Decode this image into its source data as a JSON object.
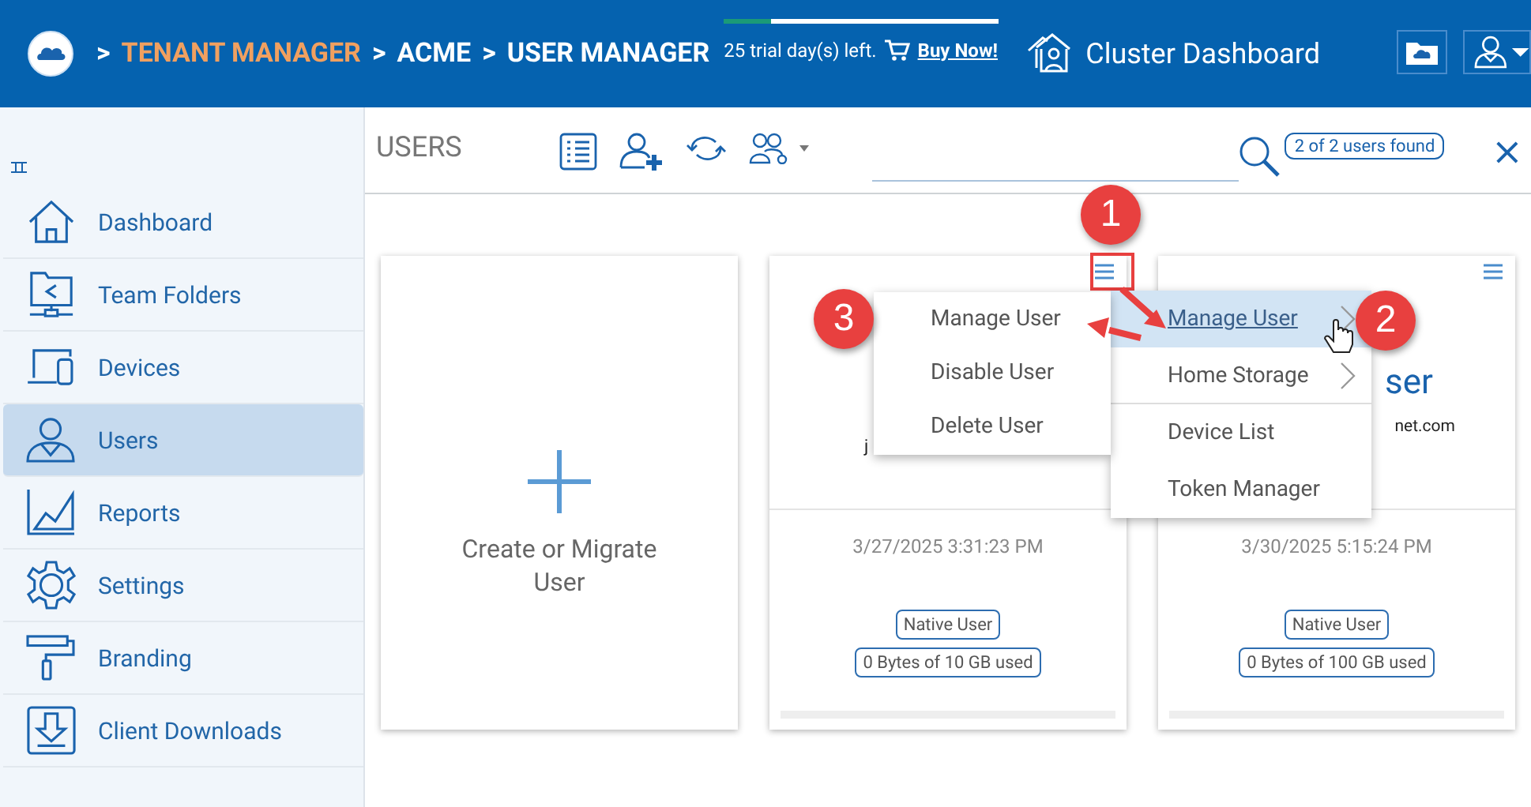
{
  "header": {
    "separator": ">",
    "breadcrumb": [
      {
        "label": "TENANT MANAGER",
        "kind": "link"
      },
      {
        "label": "ACME",
        "kind": "plain"
      },
      {
        "label": "USER MANAGER",
        "kind": "plain"
      }
    ],
    "trial": {
      "text": "25 trial day(s) left.",
      "level": 0.17,
      "buy": "Buy Now!"
    },
    "cluster": "Cluster Dashboard"
  },
  "sidebar": {
    "items": [
      {
        "label": "Dashboard",
        "selected": false
      },
      {
        "label": "Team Folders",
        "selected": false
      },
      {
        "label": "Devices",
        "selected": false
      },
      {
        "label": "Users",
        "selected": true
      },
      {
        "label": "Reports",
        "selected": false
      },
      {
        "label": "Settings",
        "selected": false
      },
      {
        "label": "Branding",
        "selected": false
      },
      {
        "label": "Client Downloads",
        "selected": false
      }
    ]
  },
  "toolbar": {
    "title": "USERS",
    "found": "2 of 2 users found",
    "close": "×"
  },
  "cards": [
    {
      "kind": "create",
      "label": "Create or Migrate User"
    },
    {
      "kind": "user",
      "email": "j",
      "date": "3/27/2025 3:31:23 PM",
      "badges": [
        "Native User",
        "0 Bytes of 10 GB used"
      ]
    },
    {
      "kind": "user",
      "name": "ser",
      "email": "net.com",
      "date": "3/30/2025 5:15:24 PM",
      "badges": [
        "Native User",
        "0 Bytes of 100 GB used"
      ]
    }
  ],
  "menu": {
    "items": [
      {
        "label": "Manage User",
        "selected": true,
        "submenu": true
      },
      {
        "label": "Home Storage",
        "selected": false,
        "submenu": true
      },
      {
        "label": "Device List",
        "selected": false,
        "submenu": false
      },
      {
        "label": "Token Manager",
        "selected": false,
        "submenu": false
      }
    ]
  },
  "submenu": {
    "items": [
      {
        "label": "Manage User",
        "selected": false
      },
      {
        "label": "Disable User",
        "selected": false
      },
      {
        "label": "Delete User",
        "selected": false
      }
    ]
  },
  "callouts": [
    {
      "number": "1"
    },
    {
      "number": "2"
    },
    {
      "number": "3"
    }
  ]
}
